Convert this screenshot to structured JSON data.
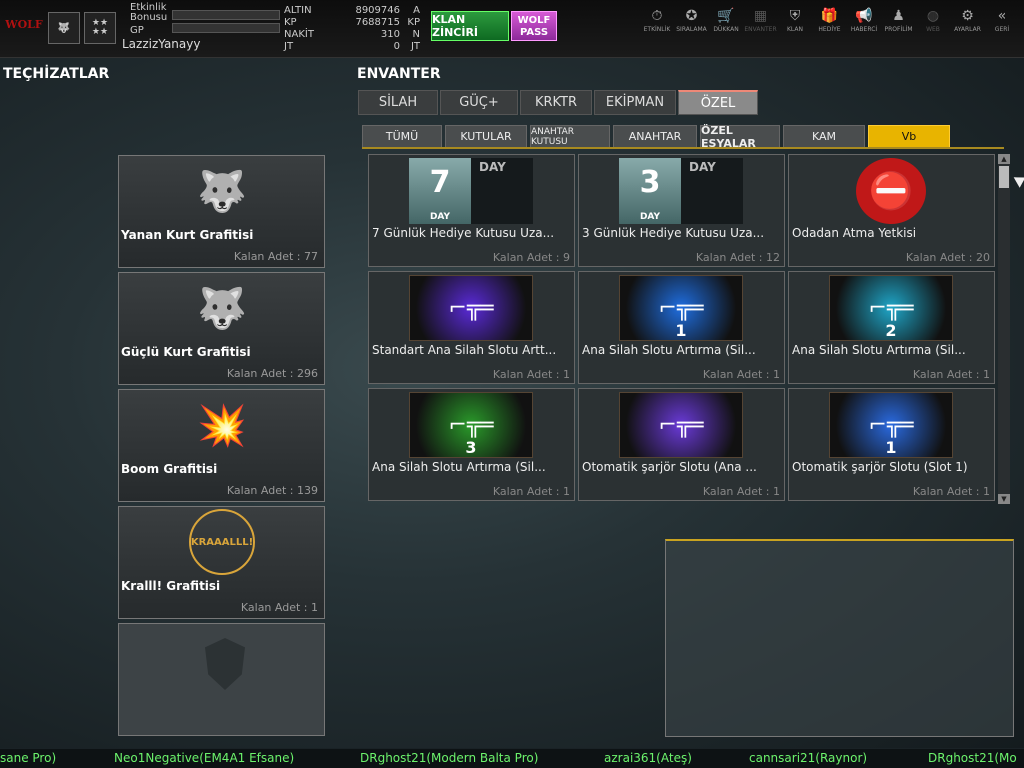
{
  "header": {
    "username": "LazzizYanayy",
    "labels": {
      "event_bonus": "Etkinlik Bonusu",
      "gp": "GP"
    },
    "logo_text": "WOLF",
    "currencies": [
      {
        "key": "ALTIN",
        "value": "8909746",
        "unit": "A"
      },
      {
        "key": "KP",
        "value": "7688715",
        "unit": "KP"
      },
      {
        "key": "NAKİT",
        "value": "310",
        "unit": "N"
      },
      {
        "key": "JT",
        "value": "0",
        "unit": "JT"
      }
    ],
    "klan_button": "KLAN ZİNCİRİ",
    "wolf_pass": "WOLF PASS",
    "nav": [
      {
        "label": "ETKİNLİK",
        "icon": "stopwatch-icon",
        "glyph": "⏱"
      },
      {
        "label": "SIRALAMA",
        "icon": "medal-icon",
        "glyph": "✪"
      },
      {
        "label": "DÜKKAN",
        "icon": "cart-icon",
        "glyph": "🛒"
      },
      {
        "label": "ENVANTER",
        "icon": "inventory-icon",
        "glyph": "▦"
      },
      {
        "label": "KLAN",
        "icon": "shield-icon",
        "glyph": "⛨"
      },
      {
        "label": "HEDİYE",
        "icon": "gift-icon",
        "glyph": "🎁"
      },
      {
        "label": "HABERCİ",
        "icon": "megaphone-icon",
        "glyph": "📢"
      },
      {
        "label": "PROFİLİM",
        "icon": "profile-icon",
        "glyph": "♟"
      },
      {
        "label": "WEB",
        "icon": "globe-icon",
        "glyph": "◍"
      },
      {
        "label": "AYARLAR",
        "icon": "gear-icon",
        "glyph": "⚙"
      },
      {
        "label": "GERİ",
        "icon": "back-icon",
        "glyph": "«"
      }
    ]
  },
  "left": {
    "title": "TEÇHİZATLAR",
    "items": [
      {
        "name": "Yanan Kurt Grafitisi",
        "count": "Kalan Adet : 77",
        "glyph": "🐺",
        "color": "#d2321e"
      },
      {
        "name": "Güçlü Kurt Grafitisi",
        "count": "Kalan Adet : 296",
        "glyph": "🐺",
        "color": "#d9d9d9"
      },
      {
        "name": "Boom Grafitisi",
        "count": "Kalan Adet : 139",
        "glyph": "💥",
        "color": "#e1a814"
      },
      {
        "name": "Kralll! Grafitisi",
        "count": "Kalan Adet : 1",
        "glyph": "KRAAALLL!",
        "color": "#d9a53a"
      }
    ]
  },
  "inventory": {
    "title": "ENVANTER",
    "tabs": [
      "SİLAH",
      "GÜÇ+",
      "KRKTR",
      "EKİPMAN",
      "ÖZEL"
    ],
    "active_tab": "ÖZEL",
    "subtabs": [
      "TÜMÜ",
      "KUTULAR",
      "ANAHTAR KUTUSU",
      "ANAHTAR",
      "ÖZEL EŞYALAR",
      "KAM",
      "Vb"
    ],
    "active_subtab": "Vb",
    "items": [
      {
        "name": "7 Günlük Hediye Kutusu Uza...",
        "count": "Kalan Adet : 9",
        "type": "day",
        "num": "7",
        "daylabel": "DAY"
      },
      {
        "name": "3 Günlük Hediye Kutusu Uza...",
        "count": "Kalan Adet : 12",
        "type": "day",
        "num": "3",
        "daylabel": "DAY"
      },
      {
        "name": "Odadan Atma Yetkisi",
        "count": "Kalan Adet : 20",
        "type": "kick"
      },
      {
        "name": "Standart Ana Silah Slotu Artt...",
        "count": "Kalan Adet : 1",
        "type": "gun",
        "num": "",
        "color": "#5a2ad8"
      },
      {
        "name": "Ana Silah Slotu Artırma (Sil...",
        "count": "Kalan Adet : 1",
        "type": "gun",
        "num": "1",
        "color": "#1f6ee0"
      },
      {
        "name": "Ana Silah Slotu Artırma (Sil...",
        "count": "Kalan Adet : 1",
        "type": "gun",
        "num": "2",
        "color": "#1fa6c8"
      },
      {
        "name": "Ana Silah Slotu Artırma (Sil...",
        "count": "Kalan Adet : 1",
        "type": "gun",
        "num": "3",
        "color": "#2a9a2a"
      },
      {
        "name": "Otomatik şarjör Slotu (Ana ...",
        "count": "Kalan Adet : 1",
        "type": "gun",
        "num": "",
        "color": "#6a3ad8"
      },
      {
        "name": "Otomatik şarjör Slotu (Slot 1)",
        "count": "Kalan Adet : 1",
        "type": "gun",
        "num": "1",
        "color": "#2a6ae0"
      }
    ]
  },
  "ticker": [
    "sane Pro)",
    "Neo1Negative(EM4A1 Efsane)",
    "DRghost21(Modern Balta Pro)",
    "azrai361(Ateş)",
    "cannsari21(Raynor)",
    "DRghost21(Mo"
  ]
}
